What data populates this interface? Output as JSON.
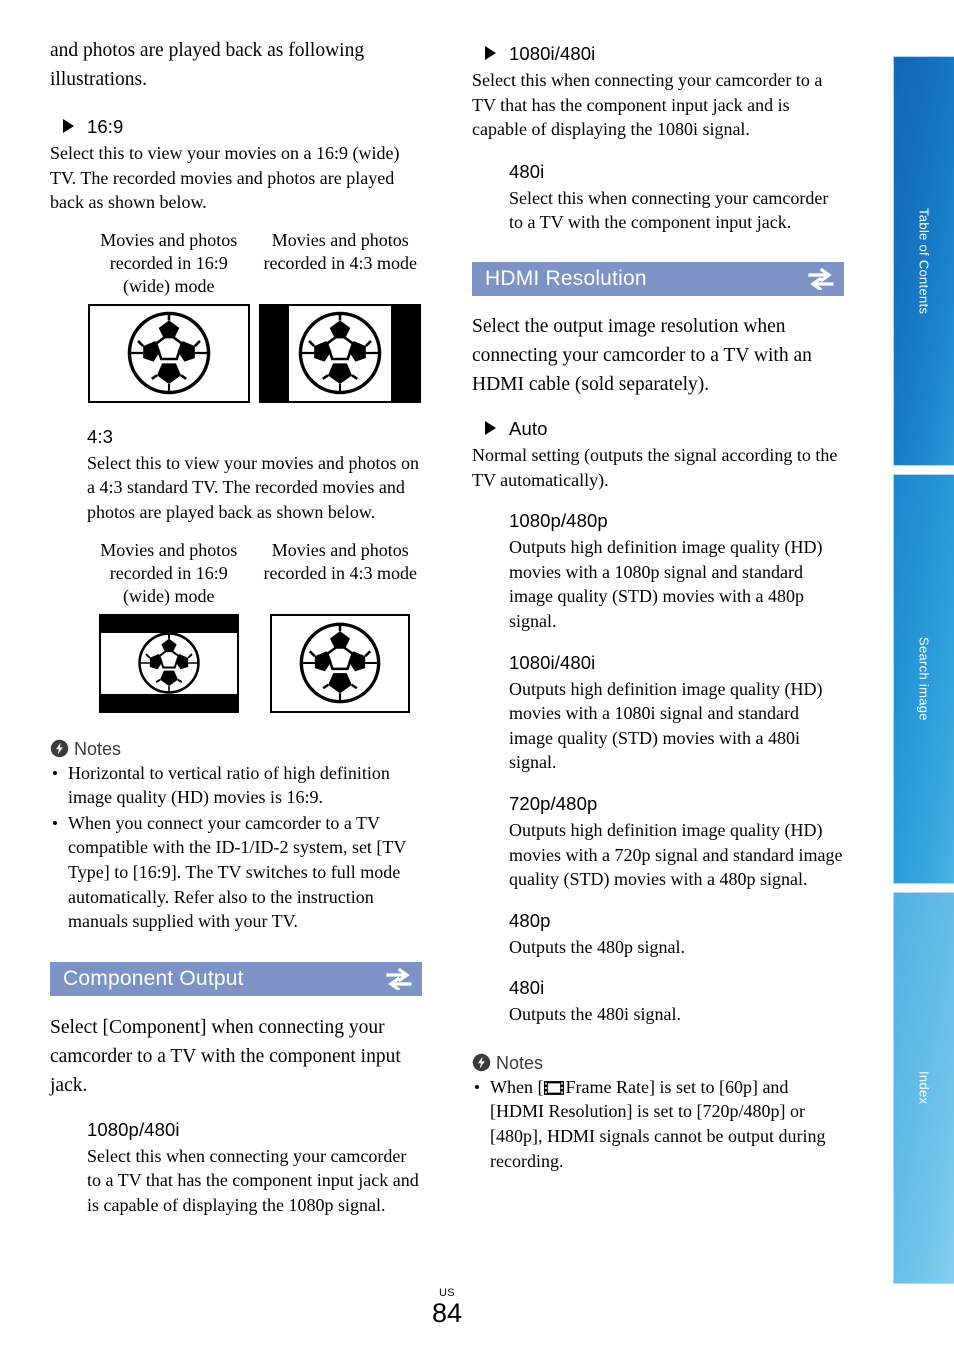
{
  "left_column": {
    "intro_text": "and photos are played back as following illustrations.",
    "option_169": {
      "title": "16:9",
      "desc": "Select this to view your movies on a 16:9 (wide) TV. The recorded movies and photos are played back as shown below."
    },
    "illus1": {
      "caption_a": "Movies and photos recorded in 16:9 (wide) mode",
      "caption_b": "Movies and photos recorded in 4:3 mode"
    },
    "option_43": {
      "title": "4:3",
      "desc": "Select this to view your movies and photos on a 4:3 standard TV. The recorded movies and photos are played back as shown below."
    },
    "illus2": {
      "caption_a": "Movies and photos recorded in 16:9 (wide) mode",
      "caption_b": "Movies and photos recorded in 4:3 mode"
    },
    "notes": {
      "label": "Notes",
      "items": [
        "Horizontal to vertical ratio of high definition image quality (HD) movies is 16:9.",
        "When you connect your camcorder to a TV compatible with the ID-1/ID-2 system, set [TV Type] to [16:9]. The TV switches to full mode automatically. Refer also to the instruction manuals supplied with your TV."
      ]
    },
    "component_section": {
      "title": "Component Output",
      "intro": "Select [Component] when connecting your camcorder to a TV with the component input jack.",
      "options": [
        {
          "title": "1080p/480i",
          "desc": "Select this when connecting your camcorder to a TV that has the component input jack and is capable of displaying the 1080p signal."
        }
      ]
    }
  },
  "right_column": {
    "component_options_cont": [
      {
        "title": "1080i/480i",
        "desc": "Select this when connecting your camcorder to a TV that has the component input jack and is capable of displaying the 1080i signal.",
        "arrow": true
      },
      {
        "title": "480i",
        "desc": "Select this when connecting your camcorder to a TV with the component input jack.",
        "arrow": false
      }
    ],
    "hdmi_section": {
      "title": "HDMI Resolution",
      "intro": "Select the output image resolution when connecting your camcorder to a TV with an HDMI cable (sold separately).",
      "options": [
        {
          "title": "Auto",
          "desc": "Normal setting (outputs the signal according to the TV automatically).",
          "arrow": true
        },
        {
          "title": "1080p/480p",
          "desc": "Outputs high definition image quality (HD) movies with a 1080p signal and standard image quality (STD) movies with a 480p signal.",
          "arrow": false
        },
        {
          "title": "1080i/480i",
          "desc": "Outputs high definition image quality (HD) movies with a 1080i signal and standard image quality (STD) movies with a 480i signal.",
          "arrow": false
        },
        {
          "title": "720p/480p",
          "desc": "Outputs high definition image quality (HD) movies with a 720p signal and standard image quality (STD) movies with a 480p signal.",
          "arrow": false
        },
        {
          "title": "480p",
          "desc": "Outputs the 480p signal.",
          "arrow": false
        },
        {
          "title": "480i",
          "desc": "Outputs the 480i signal.",
          "arrow": false
        }
      ]
    },
    "notes": {
      "label": "Notes",
      "item_prefix": "When [",
      "item_suffix": "Frame Rate] is set to [60p] and [HDMI Resolution] is set to [720p/480p] or [480p], HDMI signals cannot be output during recording."
    }
  },
  "side_tabs": [
    {
      "label": "Table of Contents"
    },
    {
      "label": "Search image"
    },
    {
      "label": "Index"
    }
  ],
  "footer": {
    "region": "US",
    "page_number": "84"
  },
  "colors": {
    "section_bar": "#7d93c6",
    "section_bar_text": "#ffffff",
    "tab_toc": "#1570bd",
    "tab_search": "#2292d4",
    "tab_index": "#5cb8e4",
    "text": "#000000",
    "notes_label": "#3b3b3b"
  }
}
